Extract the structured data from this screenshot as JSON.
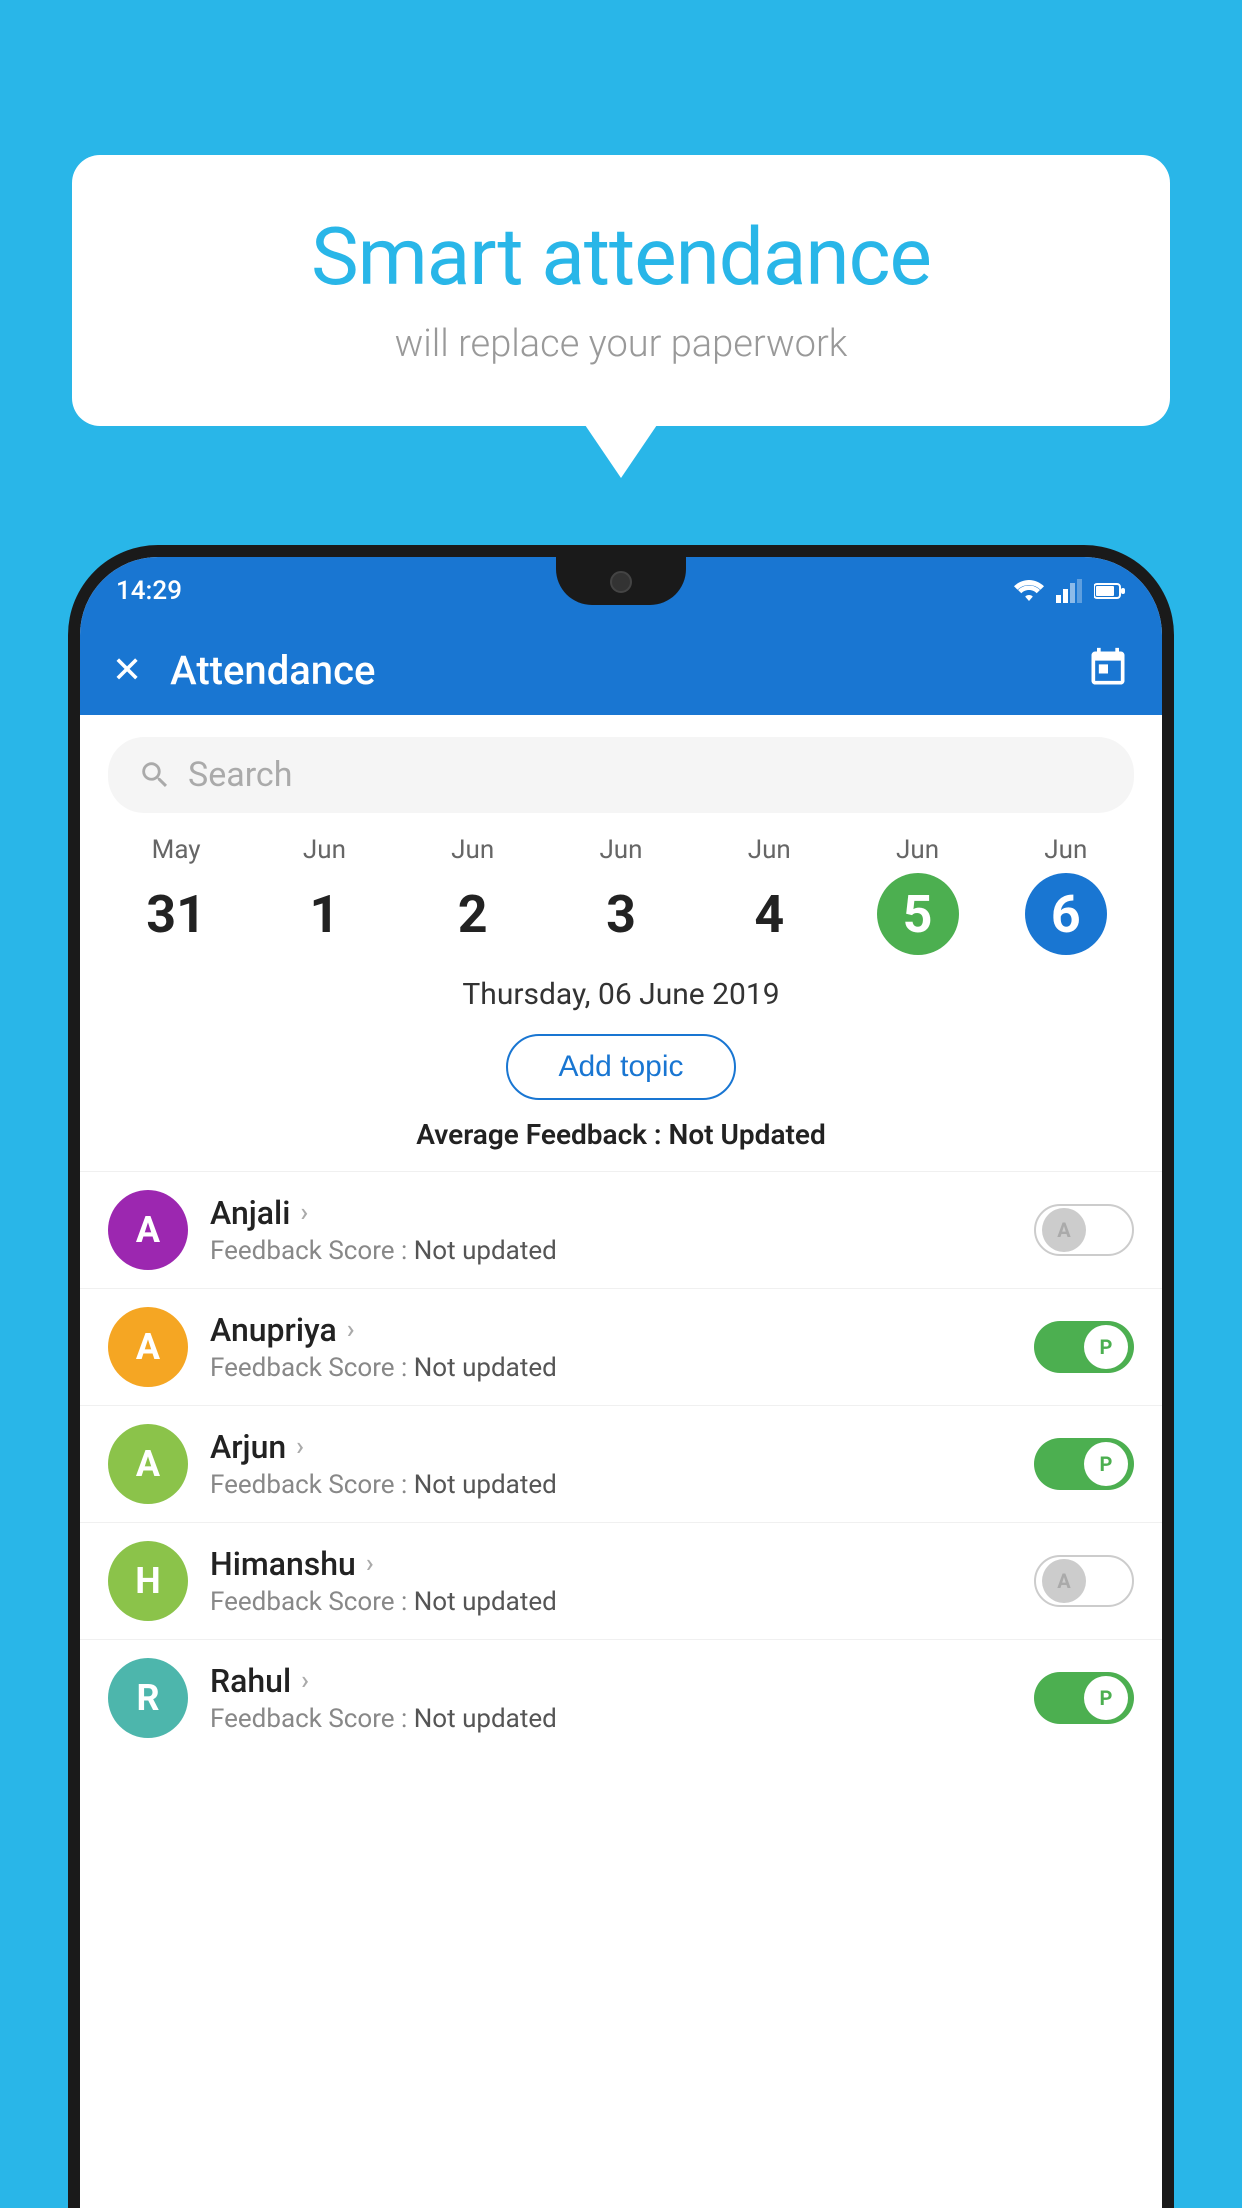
{
  "background_color": "#29b6e8",
  "speech_bubble": {
    "title": "Smart attendance",
    "subtitle": "will replace your paperwork"
  },
  "status_bar": {
    "time": "14:29",
    "wifi_icon": "wifi-icon",
    "signal_icon": "signal-icon",
    "battery_icon": "battery-icon"
  },
  "header": {
    "close_icon": "close-icon",
    "title": "Attendance",
    "calendar_icon": "calendar-icon"
  },
  "search": {
    "placeholder": "Search",
    "search_icon": "search-icon"
  },
  "dates": [
    {
      "month": "May",
      "day": "31",
      "style": "normal"
    },
    {
      "month": "Jun",
      "day": "1",
      "style": "normal"
    },
    {
      "month": "Jun",
      "day": "2",
      "style": "normal"
    },
    {
      "month": "Jun",
      "day": "3",
      "style": "normal"
    },
    {
      "month": "Jun",
      "day": "4",
      "style": "normal"
    },
    {
      "month": "Jun",
      "day": "5",
      "style": "today"
    },
    {
      "month": "Jun",
      "day": "6",
      "style": "selected"
    }
  ],
  "selected_date_label": "Thursday, 06 June 2019",
  "add_topic_label": "Add topic",
  "average_feedback_label": "Average Feedback :",
  "average_feedback_value": "Not Updated",
  "students": [
    {
      "name": "Anjali",
      "avatar_letter": "A",
      "avatar_color": "#9c27b0",
      "feedback_label": "Feedback Score :",
      "feedback_value": "Not updated",
      "toggle_state": "off",
      "toggle_letter": "A"
    },
    {
      "name": "Anupriya",
      "avatar_letter": "A",
      "avatar_color": "#f5a623",
      "feedback_label": "Feedback Score :",
      "feedback_value": "Not updated",
      "toggle_state": "on",
      "toggle_letter": "P"
    },
    {
      "name": "Arjun",
      "avatar_letter": "A",
      "avatar_color": "#8bc34a",
      "feedback_label": "Feedback Score :",
      "feedback_value": "Not updated",
      "toggle_state": "on",
      "toggle_letter": "P"
    },
    {
      "name": "Himanshu",
      "avatar_letter": "H",
      "avatar_color": "#8bc34a",
      "feedback_label": "Feedback Score :",
      "feedback_value": "Not updated",
      "toggle_state": "off",
      "toggle_letter": "A"
    },
    {
      "name": "Rahul",
      "avatar_letter": "R",
      "avatar_color": "#4db6ac",
      "feedback_label": "Feedback Score :",
      "feedback_value": "Not updated",
      "toggle_state": "on",
      "toggle_letter": "P"
    }
  ]
}
